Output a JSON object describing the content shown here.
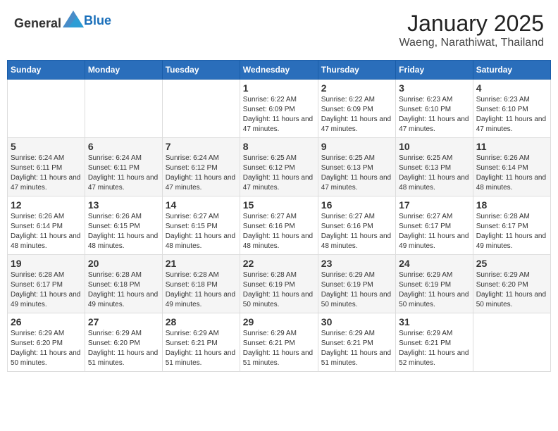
{
  "header": {
    "logo_general": "General",
    "logo_blue": "Blue",
    "month_title": "January 2025",
    "location": "Waeng, Narathiwat, Thailand"
  },
  "days_of_week": [
    "Sunday",
    "Monday",
    "Tuesday",
    "Wednesday",
    "Thursday",
    "Friday",
    "Saturday"
  ],
  "weeks": [
    [
      {
        "day": "",
        "info": ""
      },
      {
        "day": "",
        "info": ""
      },
      {
        "day": "",
        "info": ""
      },
      {
        "day": "1",
        "info": "Sunrise: 6:22 AM\nSunset: 6:09 PM\nDaylight: 11 hours and 47 minutes."
      },
      {
        "day": "2",
        "info": "Sunrise: 6:22 AM\nSunset: 6:09 PM\nDaylight: 11 hours and 47 minutes."
      },
      {
        "day": "3",
        "info": "Sunrise: 6:23 AM\nSunset: 6:10 PM\nDaylight: 11 hours and 47 minutes."
      },
      {
        "day": "4",
        "info": "Sunrise: 6:23 AM\nSunset: 6:10 PM\nDaylight: 11 hours and 47 minutes."
      }
    ],
    [
      {
        "day": "5",
        "info": "Sunrise: 6:24 AM\nSunset: 6:11 PM\nDaylight: 11 hours and 47 minutes."
      },
      {
        "day": "6",
        "info": "Sunrise: 6:24 AM\nSunset: 6:11 PM\nDaylight: 11 hours and 47 minutes."
      },
      {
        "day": "7",
        "info": "Sunrise: 6:24 AM\nSunset: 6:12 PM\nDaylight: 11 hours and 47 minutes."
      },
      {
        "day": "8",
        "info": "Sunrise: 6:25 AM\nSunset: 6:12 PM\nDaylight: 11 hours and 47 minutes."
      },
      {
        "day": "9",
        "info": "Sunrise: 6:25 AM\nSunset: 6:13 PM\nDaylight: 11 hours and 47 minutes."
      },
      {
        "day": "10",
        "info": "Sunrise: 6:25 AM\nSunset: 6:13 PM\nDaylight: 11 hours and 48 minutes."
      },
      {
        "day": "11",
        "info": "Sunrise: 6:26 AM\nSunset: 6:14 PM\nDaylight: 11 hours and 48 minutes."
      }
    ],
    [
      {
        "day": "12",
        "info": "Sunrise: 6:26 AM\nSunset: 6:14 PM\nDaylight: 11 hours and 48 minutes."
      },
      {
        "day": "13",
        "info": "Sunrise: 6:26 AM\nSunset: 6:15 PM\nDaylight: 11 hours and 48 minutes."
      },
      {
        "day": "14",
        "info": "Sunrise: 6:27 AM\nSunset: 6:15 PM\nDaylight: 11 hours and 48 minutes."
      },
      {
        "day": "15",
        "info": "Sunrise: 6:27 AM\nSunset: 6:16 PM\nDaylight: 11 hours and 48 minutes."
      },
      {
        "day": "16",
        "info": "Sunrise: 6:27 AM\nSunset: 6:16 PM\nDaylight: 11 hours and 48 minutes."
      },
      {
        "day": "17",
        "info": "Sunrise: 6:27 AM\nSunset: 6:17 PM\nDaylight: 11 hours and 49 minutes."
      },
      {
        "day": "18",
        "info": "Sunrise: 6:28 AM\nSunset: 6:17 PM\nDaylight: 11 hours and 49 minutes."
      }
    ],
    [
      {
        "day": "19",
        "info": "Sunrise: 6:28 AM\nSunset: 6:17 PM\nDaylight: 11 hours and 49 minutes."
      },
      {
        "day": "20",
        "info": "Sunrise: 6:28 AM\nSunset: 6:18 PM\nDaylight: 11 hours and 49 minutes."
      },
      {
        "day": "21",
        "info": "Sunrise: 6:28 AM\nSunset: 6:18 PM\nDaylight: 11 hours and 49 minutes."
      },
      {
        "day": "22",
        "info": "Sunrise: 6:28 AM\nSunset: 6:19 PM\nDaylight: 11 hours and 50 minutes."
      },
      {
        "day": "23",
        "info": "Sunrise: 6:29 AM\nSunset: 6:19 PM\nDaylight: 11 hours and 50 minutes."
      },
      {
        "day": "24",
        "info": "Sunrise: 6:29 AM\nSunset: 6:19 PM\nDaylight: 11 hours and 50 minutes."
      },
      {
        "day": "25",
        "info": "Sunrise: 6:29 AM\nSunset: 6:20 PM\nDaylight: 11 hours and 50 minutes."
      }
    ],
    [
      {
        "day": "26",
        "info": "Sunrise: 6:29 AM\nSunset: 6:20 PM\nDaylight: 11 hours and 50 minutes."
      },
      {
        "day": "27",
        "info": "Sunrise: 6:29 AM\nSunset: 6:20 PM\nDaylight: 11 hours and 51 minutes."
      },
      {
        "day": "28",
        "info": "Sunrise: 6:29 AM\nSunset: 6:21 PM\nDaylight: 11 hours and 51 minutes."
      },
      {
        "day": "29",
        "info": "Sunrise: 6:29 AM\nSunset: 6:21 PM\nDaylight: 11 hours and 51 minutes."
      },
      {
        "day": "30",
        "info": "Sunrise: 6:29 AM\nSunset: 6:21 PM\nDaylight: 11 hours and 51 minutes."
      },
      {
        "day": "31",
        "info": "Sunrise: 6:29 AM\nSunset: 6:21 PM\nDaylight: 11 hours and 52 minutes."
      },
      {
        "day": "",
        "info": ""
      }
    ]
  ]
}
